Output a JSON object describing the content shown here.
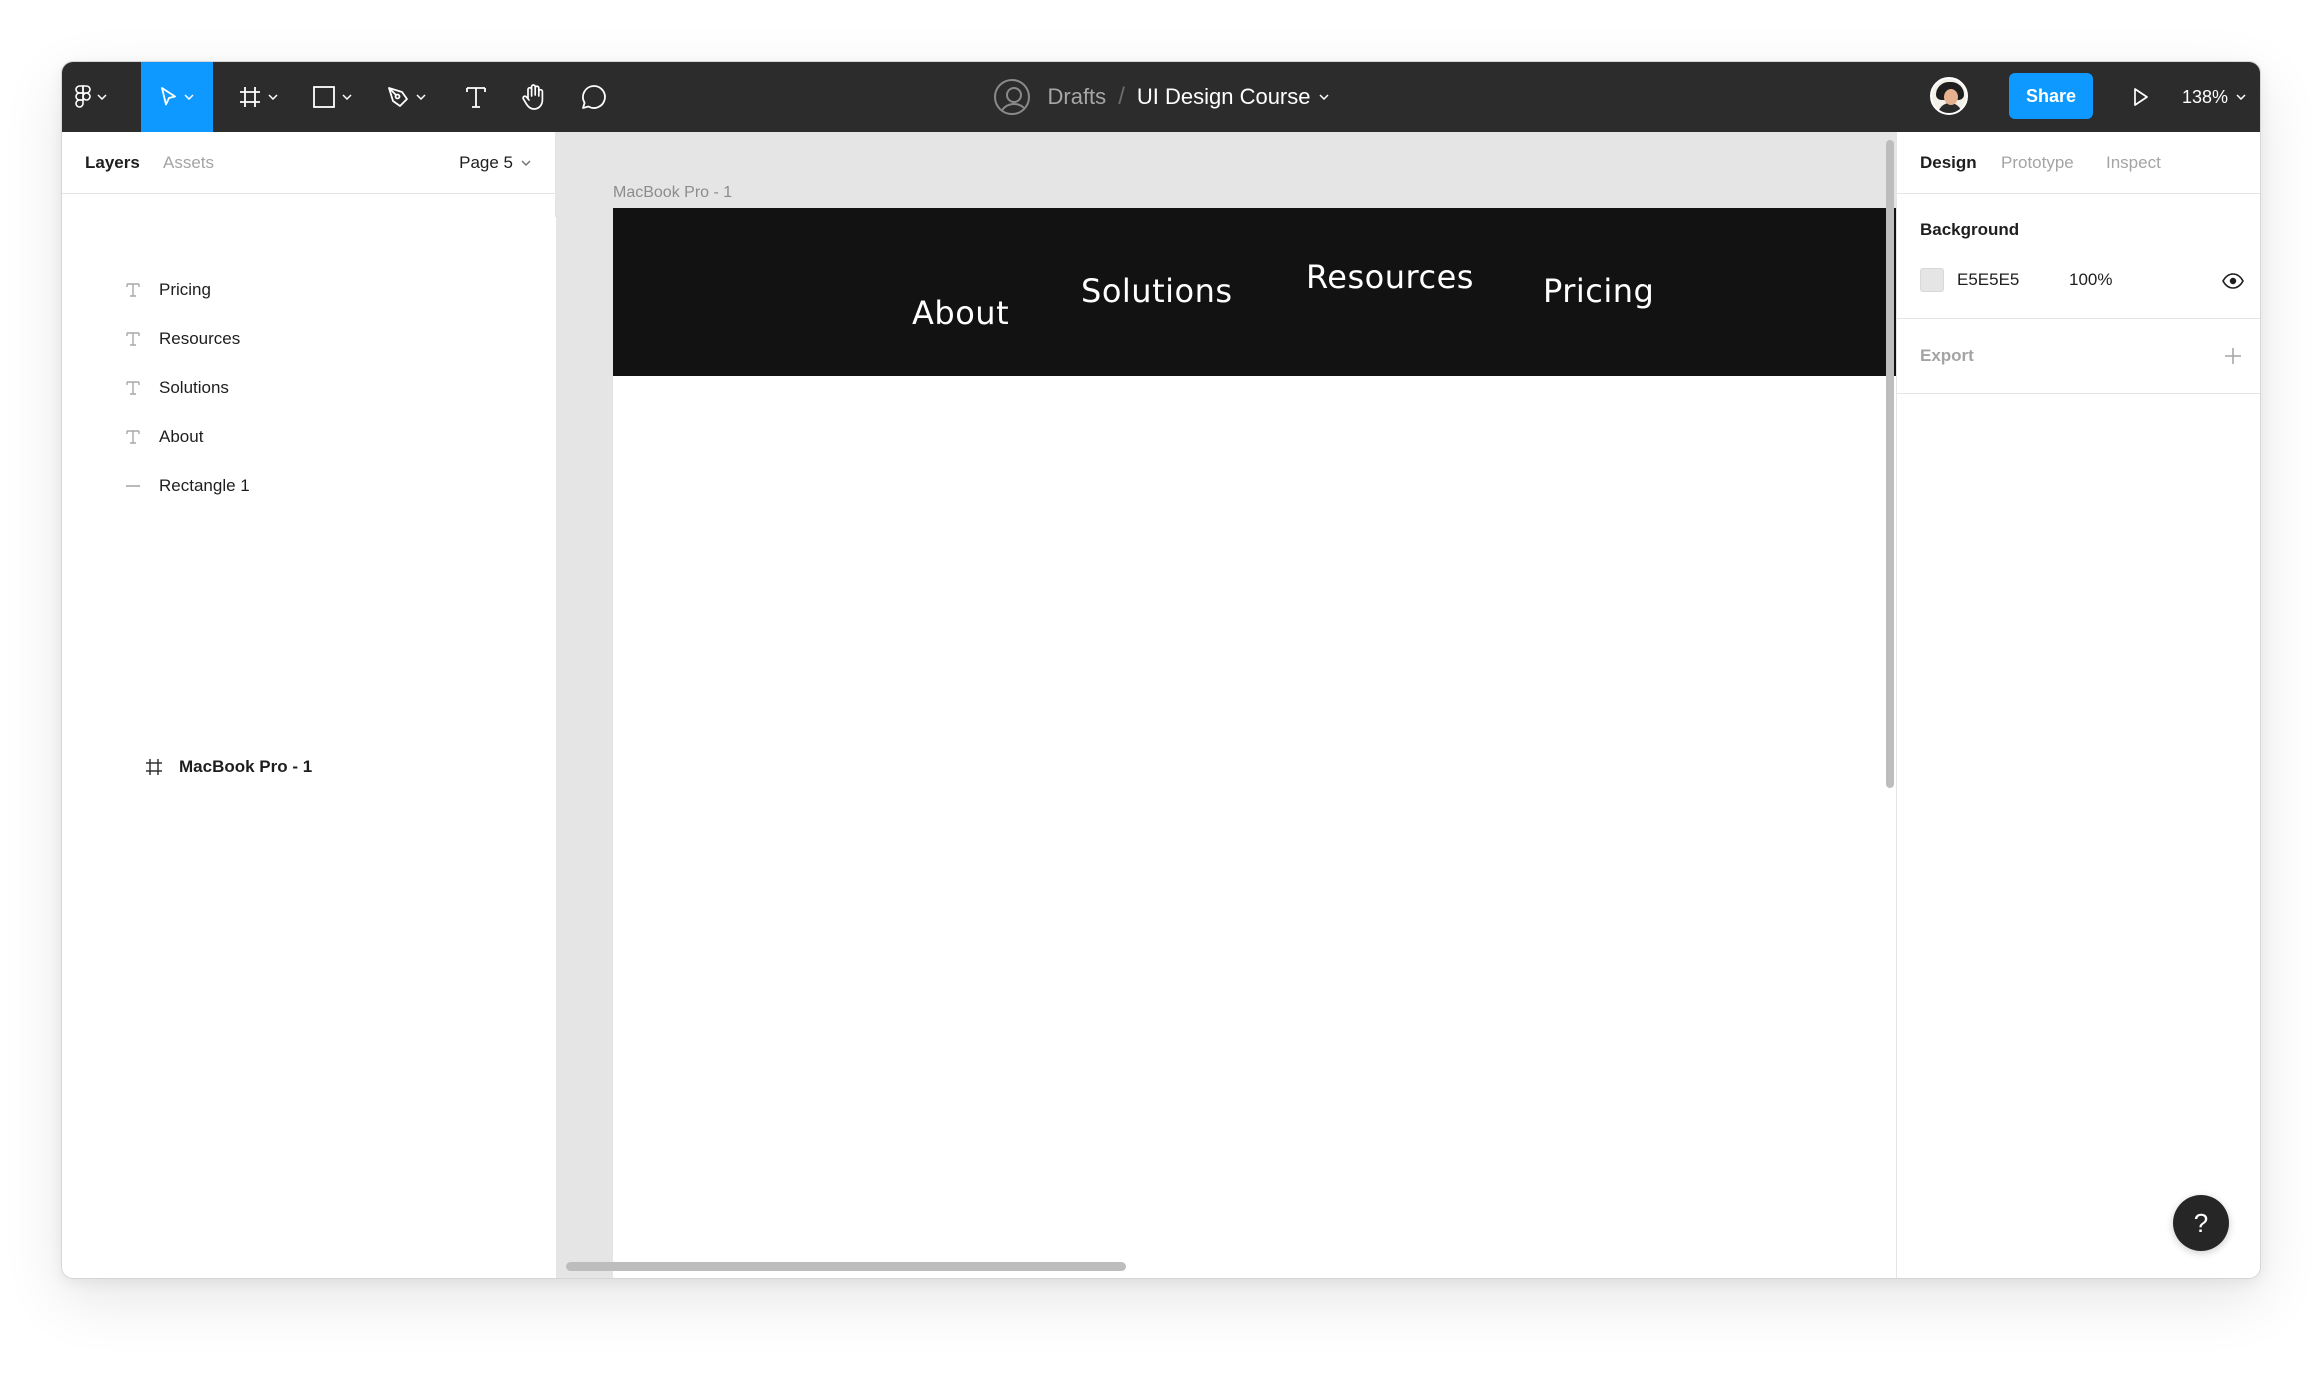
{
  "breadcrumb": {
    "drafts": "Drafts",
    "separator": "/",
    "file": "UI Design Course"
  },
  "toolbar": {
    "share_label": "Share",
    "zoom": "138%"
  },
  "left_panel": {
    "tabs": [
      {
        "label": "Layers"
      },
      {
        "label": "Assets"
      }
    ],
    "page": "Page 5",
    "layers": [
      {
        "name": "MacBook Pro - 1",
        "icon": "frame-icon"
      },
      {
        "name": "Pricing",
        "icon": "text-layer-icon"
      },
      {
        "name": "Resources",
        "icon": "text-layer-icon"
      },
      {
        "name": "Solutions",
        "icon": "text-layer-icon"
      },
      {
        "name": "About",
        "icon": "text-layer-icon"
      },
      {
        "name": "Rectangle 1",
        "icon": "rectangle-layer-icon"
      }
    ]
  },
  "canvas": {
    "frame_label": "MacBook Pro - 1",
    "frame_background": "#FFFFFF",
    "navbar_color": "#121212",
    "nav": {
      "about": "About",
      "solutions": "Solutions",
      "resources": "Resources",
      "pricing": "Pricing"
    }
  },
  "right_panel": {
    "tabs": [
      {
        "label": "Design"
      },
      {
        "label": "Prototype"
      },
      {
        "label": "Inspect"
      }
    ],
    "background": {
      "title": "Background",
      "hex": "E5E5E5",
      "opacity": "100%",
      "color": "#E5E5E5"
    },
    "export": {
      "title": "Export"
    }
  },
  "help": {
    "label": "?"
  },
  "colors": {
    "accent": "#0D99FF",
    "toolbar": "#2C2C2C"
  }
}
